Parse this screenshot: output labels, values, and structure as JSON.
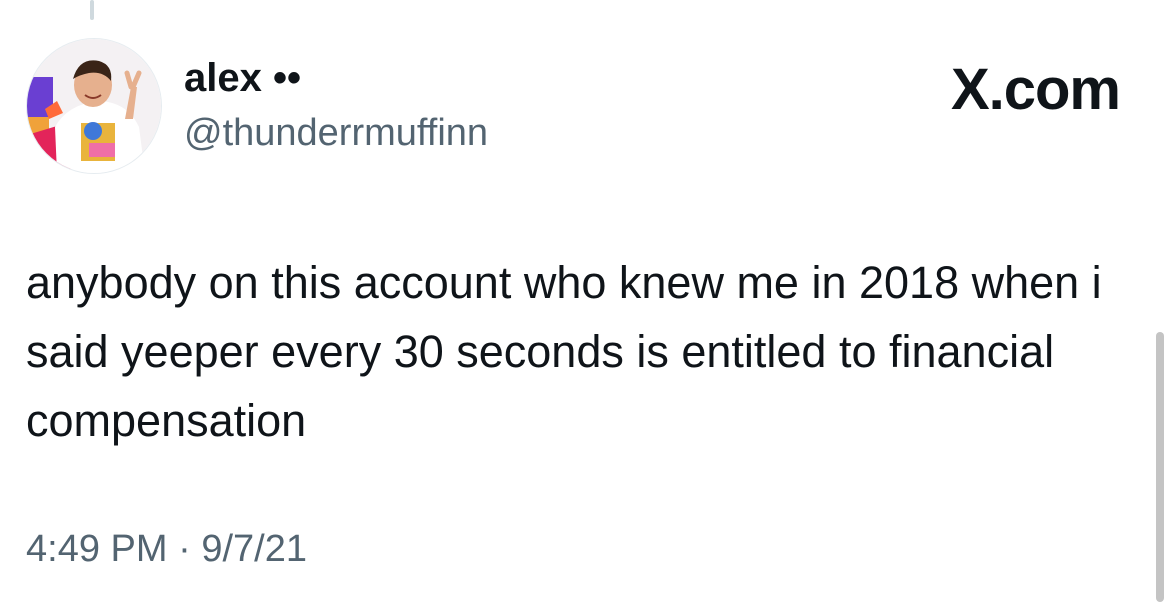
{
  "tweet": {
    "author": {
      "display_name": "alex ••",
      "handle": "@thunderrmuffinn"
    },
    "site": "X.com",
    "text": "anybody on this account who knew me in 2018 when i said yeeper every 30 seconds is entitled to financial compensation",
    "time": "4:49 PM",
    "separator": "·",
    "date": "9/7/21"
  }
}
